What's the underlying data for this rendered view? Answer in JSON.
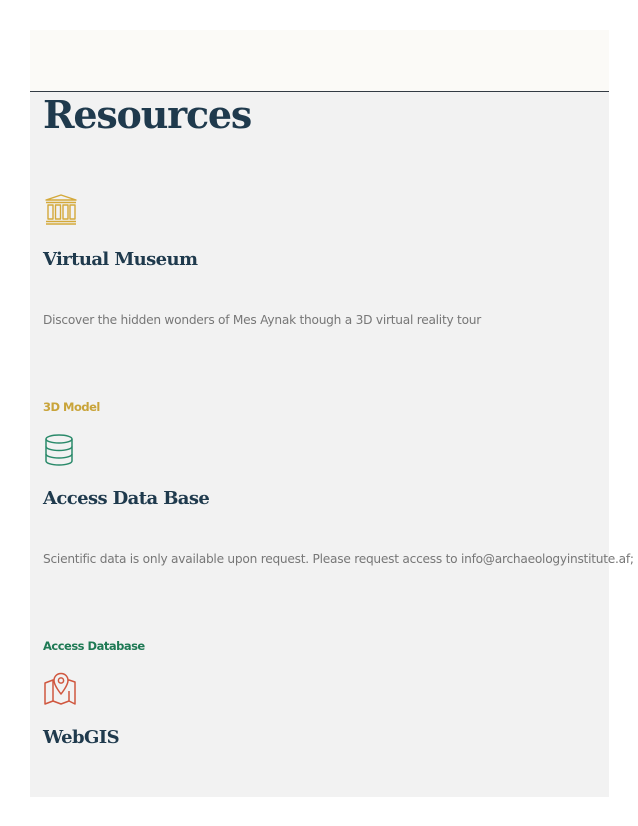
{
  "page": {
    "title": "Resources"
  },
  "resources": [
    {
      "icon": "museum-icon",
      "icon_color": "#d4a93a",
      "title": "Virtual Museum",
      "description": "Discover the hidden wonders of Mes Aynak though a 3D virtual reality tour",
      "link_label": "3D Model",
      "link_color": "#c9a43a"
    },
    {
      "icon": "database-icon",
      "icon_color": "#2a8a6a",
      "title": "Access Data Base",
      "description": "Scientific data is only available upon request. Please request access to info@archaeologyinstitute.af;",
      "link_label": "Access Database",
      "link_color": "#1f7a55"
    },
    {
      "icon": "map-pin-icon",
      "icon_color": "#d0573f",
      "title": "WebGIS"
    }
  ],
  "colors": {
    "heading": "#1f3a4d",
    "panel_bg": "#f2f2f2",
    "band_bg": "#fbfaf7"
  }
}
